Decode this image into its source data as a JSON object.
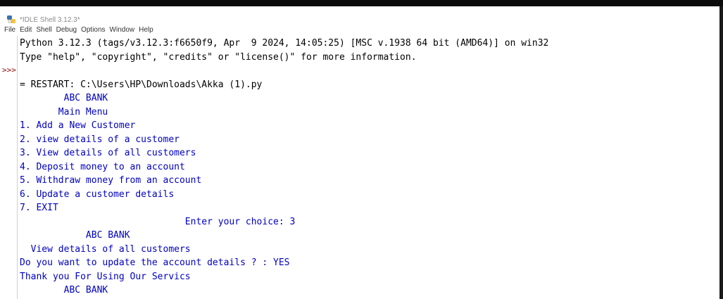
{
  "window": {
    "title": "*IDLE Shell 3.12.3*"
  },
  "menu": [
    "File",
    "Edit",
    "Shell",
    "Debug",
    "Options",
    "Window",
    "Help"
  ],
  "gutter": {
    "prompt": ">>>"
  },
  "shell": {
    "lines": [
      {
        "text": "Python 3.12.3 (tags/v3.12.3:f6650f9, Apr  9 2024, 14:05:25) [MSC v.1938 64 bit (AMD64)] on win32",
        "style": "black"
      },
      {
        "text": "Type \"help\", \"copyright\", \"credits\" or \"license()\" for more information.",
        "style": "black"
      },
      {
        "text": "",
        "style": "black"
      },
      {
        "text": "= RESTART: C:\\Users\\HP\\Downloads\\Akka (1).py",
        "style": "black"
      },
      {
        "text": "        ABC BANK",
        "style": "blue"
      },
      {
        "text": "       Main Menu",
        "style": "blue"
      },
      {
        "text": "1. Add a New Customer",
        "style": "blue"
      },
      {
        "text": "2. view details of a customer",
        "style": "blue"
      },
      {
        "text": "3. View details of all customers",
        "style": "blue"
      },
      {
        "text": "4. Deposit money to an account",
        "style": "blue"
      },
      {
        "text": "5. Withdraw money from an account",
        "style": "blue"
      },
      {
        "text": "6. Update a customer details",
        "style": "blue"
      },
      {
        "text": "7. EXIT",
        "style": "blue"
      },
      {
        "text": "                              Enter your choice: 3",
        "style": "blue"
      },
      {
        "text": "            ABC BANK",
        "style": "blue"
      },
      {
        "text": "  View details of all customers",
        "style": "blue"
      },
      {
        "text": "Do you want to update the account details ? : YES",
        "style": "blue"
      },
      {
        "text": "Thank you For Using Our Servics",
        "style": "blue"
      },
      {
        "text": "        ABC BANK",
        "style": "blue"
      }
    ]
  },
  "colors": {
    "prompt": "#8b0000",
    "output": "#0000c0",
    "banner": "#000000"
  }
}
